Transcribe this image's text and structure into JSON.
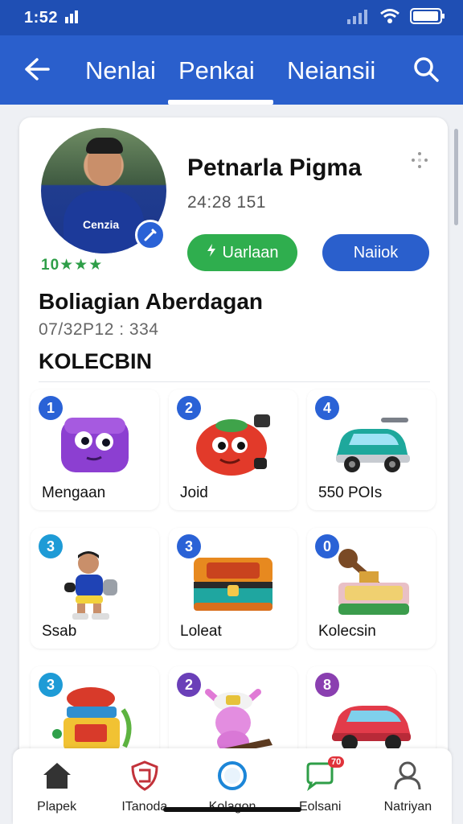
{
  "status_bar": {
    "time": "1:52"
  },
  "topnav": {
    "tabs": [
      {
        "label": "Nenlai"
      },
      {
        "label": "Penkai"
      },
      {
        "label": "Neiansii"
      }
    ],
    "active_tab": 1
  },
  "profile": {
    "name": "Petnarla Pigma",
    "meta": "24:28  151",
    "rating": "10★★★",
    "avatar_text": "Cenzia",
    "primary_button": "Uarlaan",
    "secondary_button": "Naiiok"
  },
  "section": {
    "title": "Boliagian Aberdagan",
    "subtitle": "07/32P12 : 334",
    "collection_header": "KOLECBIN"
  },
  "items": [
    {
      "num": "1",
      "label": "Mengaan",
      "num_color": "#2a62d6",
      "icon": "purple-cube-icon"
    },
    {
      "num": "2",
      "label": "Joid",
      "num_color": "#2a62d6",
      "icon": "red-robot-icon"
    },
    {
      "num": "4",
      "label": "550 POIs",
      "num_color": "#2a62d6",
      "icon": "teal-car-icon"
    },
    {
      "num": "3",
      "label": "Ssab",
      "num_color": "#1e9bd6",
      "icon": "player-figure-icon"
    },
    {
      "num": "3",
      "label": "Loleat",
      "num_color": "#2a62d6",
      "icon": "treasure-chest-icon"
    },
    {
      "num": "0",
      "label": "Kolecsin",
      "num_color": "#2a62d6",
      "icon": "hammer-box-icon"
    },
    {
      "num": "3",
      "label": "",
      "num_color": "#1e9bd6",
      "icon": "tomato-cart-icon"
    },
    {
      "num": "2",
      "label": "",
      "num_color": "#6a3fb8",
      "icon": "pink-creature-icon"
    },
    {
      "num": "8",
      "label": "",
      "num_color": "#8a3fb0",
      "icon": "red-car-icon"
    }
  ],
  "bottom_nav": [
    {
      "label": "Plapek",
      "icon": "home-icon"
    },
    {
      "label": "ITanoda",
      "icon": "shield-icon"
    },
    {
      "label": "Kolagon",
      "icon": "circle-icon"
    },
    {
      "label": "Eolsani",
      "icon": "chat-badge-icon",
      "badge": "70"
    },
    {
      "label": "Natriyan",
      "icon": "user-icon"
    }
  ],
  "colors": {
    "primary": "#2a5fcc",
    "status_bar": "#1f4fb4",
    "green": "#2fae4e"
  }
}
